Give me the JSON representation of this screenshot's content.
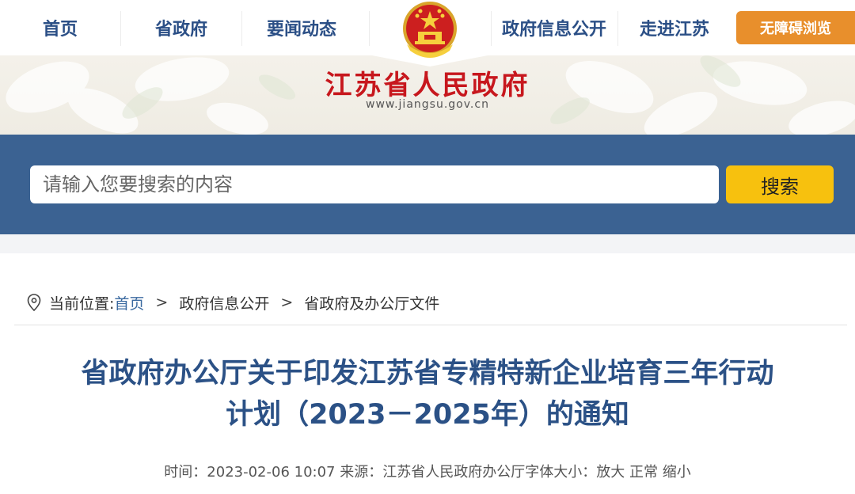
{
  "nav": {
    "items": [
      {
        "label": "首页"
      },
      {
        "label": "省政府"
      },
      {
        "label": "要闻动态"
      },
      {
        "label": "政府信息公开"
      },
      {
        "label": "走进江苏"
      }
    ],
    "accessibility_label": "无障碍浏览"
  },
  "header": {
    "site_title": "江苏省人民政府",
    "site_url": "www.jiangsu.gov.cn"
  },
  "search": {
    "placeholder": "请输入您要搜索的内容",
    "button_label": "搜索"
  },
  "breadcrumb": {
    "prefix": "当前位置:",
    "home": "首页",
    "separator": ">",
    "items": [
      "政府信息公开",
      "省政府及办公厅文件"
    ]
  },
  "article": {
    "title_line1": "省政府办公厅关于印发江苏省专精特新企业培育三年行动",
    "title_line2": "计划（2023－2025年）的通知",
    "time_label": "时间：",
    "time": "2023-02-06 10:07",
    "source_label": "来源：",
    "source": "江苏省人民政府办公厅",
    "font_size_label": "字体大小：",
    "enlarge": "放大",
    "normal": "正常",
    "shrink": "缩小"
  },
  "colors": {
    "nav_text": "#2b4f86",
    "accessibility_bg": "#e88f2c",
    "site_title": "#c7171d",
    "search_band": "#3b6292",
    "search_button": "#f7c10e",
    "article_title": "#2b5186"
  }
}
